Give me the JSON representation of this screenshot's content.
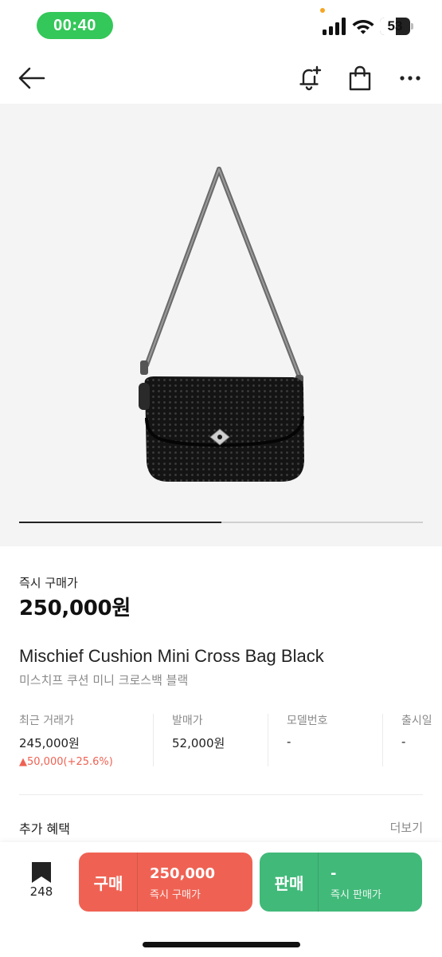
{
  "status_bar": {
    "time": "00:40",
    "battery_level": "53",
    "battery_percent": 53,
    "icons": [
      "signal-icon",
      "wifi-icon",
      "battery-icon"
    ],
    "time_pill_color": "#34c759"
  },
  "nav": {
    "icons": [
      "back-arrow-icon",
      "bell-plus-icon",
      "shopping-bag-icon",
      "more-icon"
    ]
  },
  "product": {
    "carousel_progress": 0.5,
    "price_label": "즉시 구매가",
    "price": "250,000원",
    "name_en": "Mischief Cushion Mini Cross Bag Black",
    "name_ko": "미스치프 쿠션 미니 크로스백 블랙"
  },
  "info": [
    {
      "label": "최근 거래가",
      "value": "245,000원",
      "change": "▲50,000(+25.6%)"
    },
    {
      "label": "발매가",
      "value": "52,000원"
    },
    {
      "label": "모델번호",
      "value": "-"
    },
    {
      "label": "출시일",
      "value": "-"
    }
  ],
  "benefits": {
    "title": "추가 혜택",
    "more": "더보기"
  },
  "bottom_bar": {
    "wish_icon": "bookmark-icon",
    "wish_count": "248",
    "buy": {
      "label": "구매",
      "price": "250,000",
      "sub": "즉시 구매가",
      "color": "#ef6253"
    },
    "sell": {
      "label": "판매",
      "price": "-",
      "sub": "즉시 판매가",
      "color": "#41b979"
    }
  },
  "colors": {
    "price_up": "#ef6253",
    "muted_text": "#8a8a8a"
  }
}
